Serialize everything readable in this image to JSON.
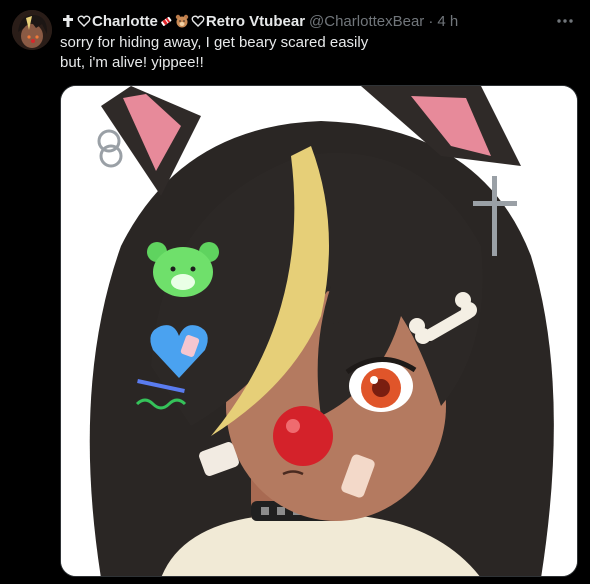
{
  "tweet": {
    "display_name_prefix": "Charlotte",
    "display_name_suffix": "Retro Vtubear",
    "handle": "@CharlottexBear",
    "separator": "·",
    "time": "4 h",
    "text_line1": "sorry for hiding away, I get beary scared easily",
    "text_line2": "but, i'm alive! yippee!!",
    "more_icon": "ellipsis-icon",
    "name_icons": [
      "cross-icon",
      "heart-outline-icon",
      "candy-icon",
      "bear-face-icon",
      "heart-outline-icon"
    ],
    "media_description_icon": "vtuber-bear-girl-artwork"
  },
  "colors": {
    "background": "#000000",
    "text_primary": "#e7e9ea",
    "text_secondary": "#71767b",
    "media_border": "#2f3336"
  }
}
